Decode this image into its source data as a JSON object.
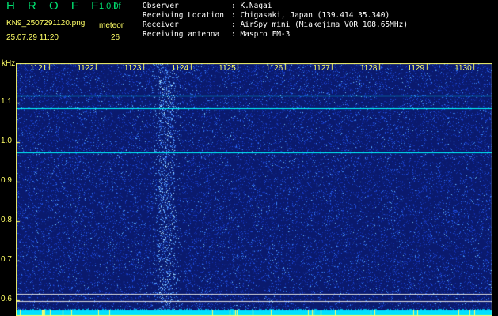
{
  "header": {
    "title": "H R O F F T",
    "version": "1.0.0f",
    "filename": "KN9_2507291120.png",
    "meteor_label": "meteor",
    "datetime": "25.07.29 11:20",
    "meteor_count": "26"
  },
  "info": [
    {
      "key": "Observer",
      "value": ": K.Nagai"
    },
    {
      "key": "Receiving Location",
      "value": ": Chigasaki, Japan (139.414 35.340)"
    },
    {
      "key": "Receiver",
      "value": ": AirSpy mini (Miakejima VOR 108.65MHz)"
    },
    {
      "key": "Receiving antenna",
      "value": ": Maspro FM-3"
    }
  ],
  "axis": {
    "y_unit": "kHz",
    "y_ticks": [
      "1.1",
      "1.0",
      "0.9",
      "0.8",
      "0.7",
      "0.6"
    ],
    "y_range": [
      0.56,
      1.2
    ],
    "x_ticks": [
      "1121",
      "1122",
      "1123",
      "1124",
      "1125",
      "1126",
      "1127",
      "1128",
      "1129",
      "1130"
    ],
    "x_range": [
      1120.3,
      1130.4
    ]
  },
  "colors": {
    "background": "#000000",
    "plot_background": "#0a1a6e",
    "label": "#ffff66",
    "title": "#00e070",
    "carrier": "#00ffff"
  },
  "features": {
    "carrier_lines_khz": [
      1.118,
      1.087,
      0.975
    ],
    "reference_lines_khz": [
      0.617,
      0.598
    ],
    "meteor_echo_minute": 1123.5
  }
}
